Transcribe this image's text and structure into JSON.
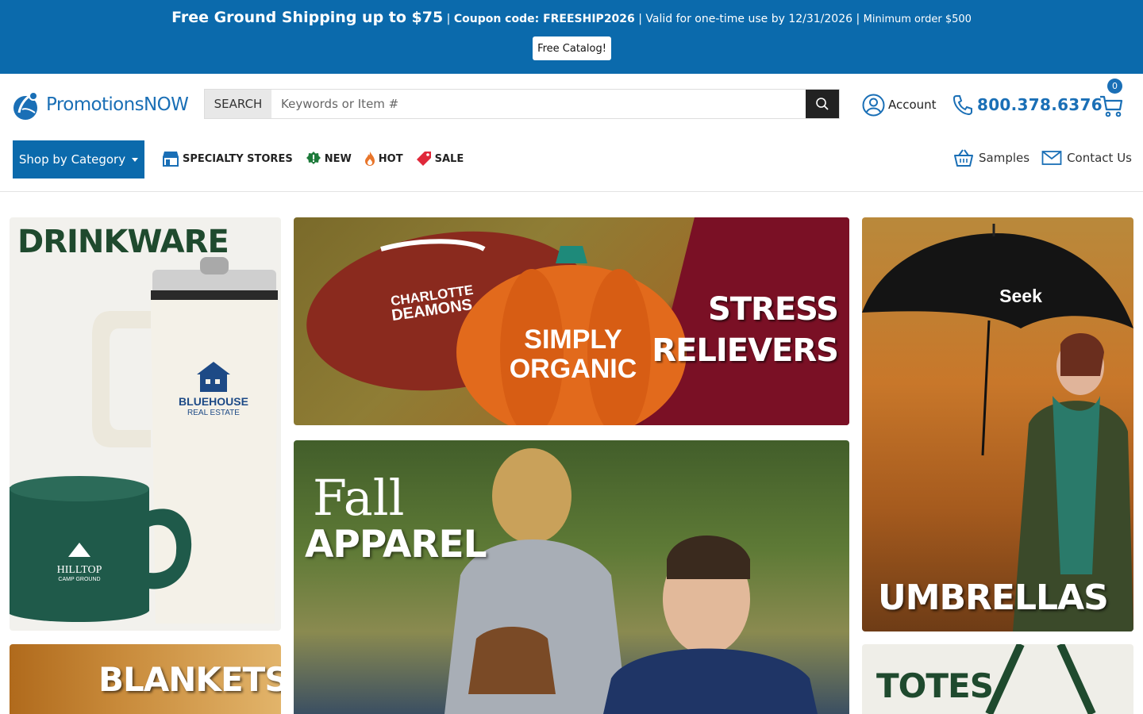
{
  "promo": {
    "headline": "Free Ground Shipping up to $75",
    "sep1": " | ",
    "coupon": "Coupon code: FREESHIP2026",
    "sep2": " | ",
    "valid": "Valid for one-time use by 12/31/2026",
    "sep3": " | ",
    "minimum": "Minimum order $500",
    "catalog_button": "Free Catalog!"
  },
  "header": {
    "logo_text": "PromotionsNOW",
    "search_label": "SEARCH",
    "search_placeholder": "Keywords or Item #",
    "account_label": "Account",
    "phone": "800.378.6376",
    "cart_count": "0"
  },
  "nav": {
    "shop_by_category": "Shop by Category",
    "links": [
      {
        "label": "SPECIALTY STORES",
        "icon": "storefront-icon"
      },
      {
        "label": "NEW",
        "icon": "new-badge-icon"
      },
      {
        "label": "HOT",
        "icon": "flame-icon"
      },
      {
        "label": "SALE",
        "icon": "price-tag-icon"
      }
    ],
    "samples": "Samples",
    "contact": "Contact Us"
  },
  "tiles": {
    "drinkware": {
      "label": "DRINKWARE",
      "mug_brand": "HILLTOP",
      "mug_sub": "CAMP GROUND",
      "tumbler_brand": "BLUEHOUSE",
      "tumbler_sub": "REAL ESTATE"
    },
    "stress": {
      "line1": "STRESS",
      "line2": "RELIEVERS",
      "football_text1": "CHARLOTTE",
      "football_text2": "DEAMONS",
      "pumpkin_text1": "SIMPLY",
      "pumpkin_text2": "ORGANIC"
    },
    "apparel": {
      "line1": "Fall",
      "line2": "APPAREL"
    },
    "umbrellas": {
      "label": "UMBRELLAS",
      "umbrella_brand": "Seek"
    },
    "blankets": {
      "label": "BLANKETS"
    },
    "totes": {
      "label": "TOTES"
    }
  },
  "colors": {
    "brand_blue": "#0b6aac",
    "dark_green": "#1f4a2e",
    "maroon": "#7a1025"
  }
}
